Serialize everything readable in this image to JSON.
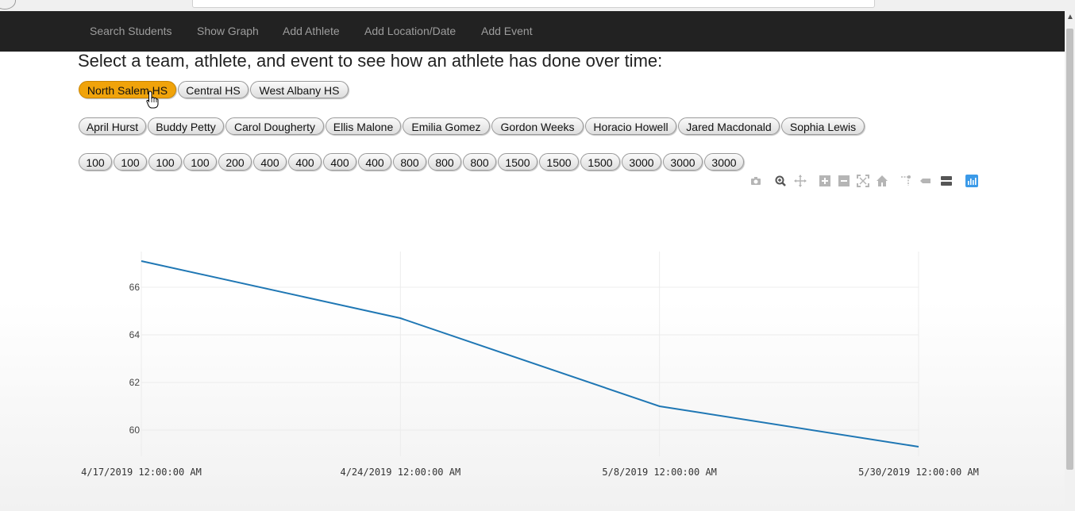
{
  "nav": {
    "items": [
      "Search Students",
      "Show Graph",
      "Add Athlete",
      "Add Location/Date",
      "Add Event"
    ]
  },
  "prompt": "Select a team, athlete, and event to see how an athlete has done over time:",
  "teams": {
    "items": [
      "North Salem HS",
      "Central HS",
      "West Albany HS"
    ],
    "selected": "North Salem HS"
  },
  "athletes": [
    "April Hurst",
    "Buddy Petty",
    "Carol Dougherty",
    "Ellis Malone",
    "Emilia Gomez",
    "Gordon Weeks",
    "Horacio Howell",
    "Jared Macdonald",
    "Sophia Lewis"
  ],
  "events": [
    "100",
    "100",
    "100",
    "100",
    "200",
    "400",
    "400",
    "400",
    "400",
    "800",
    "800",
    "800",
    "1500",
    "1500",
    "1500",
    "3000",
    "3000",
    "3000"
  ],
  "modebar_icons": [
    "camera-icon",
    "zoom-icon",
    "pan-icon",
    "zoom-in-icon",
    "zoom-out-icon",
    "autoscale-icon",
    "reset-axes-icon",
    "spike-lines-icon",
    "hover-closest-icon",
    "hover-compare-icon",
    "plotly-logo-icon"
  ],
  "colors": {
    "accent": "#f0a30a",
    "line": "#1f77b4",
    "navbar": "#222222"
  },
  "chart_data": {
    "type": "line",
    "title": "",
    "xlabel": "",
    "ylabel": "",
    "x": [
      "4/17/2019 12:00:00 AM",
      "4/24/2019 12:00:00 AM",
      "5/8/2019 12:00:00 AM",
      "5/30/2019 12:00:00 AM"
    ],
    "y": [
      67.1,
      64.7,
      61.0,
      59.3
    ],
    "yticks": [
      60,
      62,
      64,
      66
    ],
    "ylim": [
      58.9,
      67.5
    ],
    "grid": true
  }
}
